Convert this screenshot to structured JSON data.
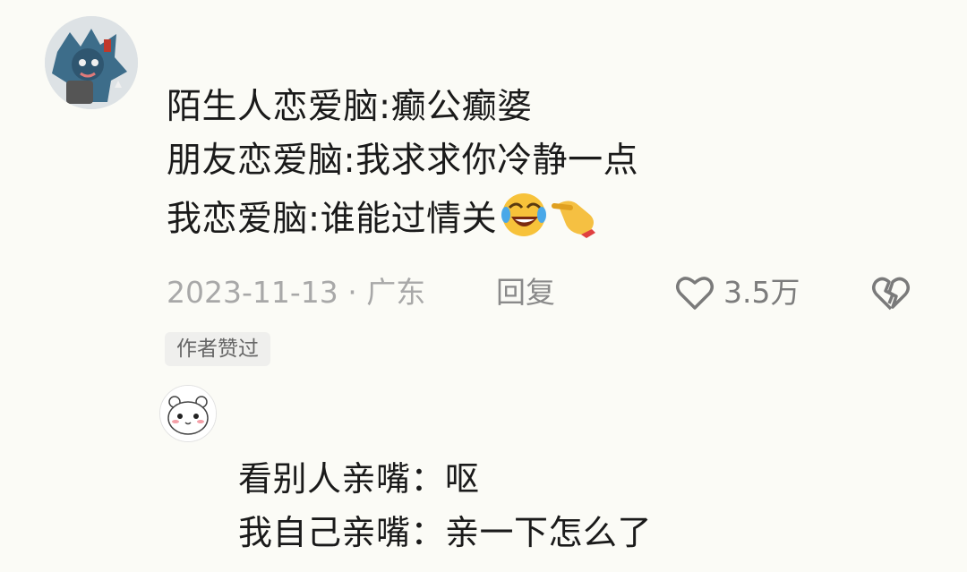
{
  "comment": {
    "lines": [
      "陌生人恋爱脑:癫公癫婆",
      "朋友恋爱脑:我求求你冷静一点",
      "我恋爱脑:谁能过情关"
    ],
    "emojis": [
      "rofl-emoji",
      "pointing-hand-emoji"
    ],
    "date": "2023-11-13 · 广东",
    "reply_label": "回复",
    "like_count": "3.5万",
    "author_badge": "作者赞过"
  },
  "reply": {
    "lines": [
      "看别人亲嘴：呕",
      "我自己亲嘴：亲一下怎么了"
    ]
  },
  "colors": {
    "background": "#fbfbf6",
    "text": "#1a1a1a",
    "meta_text": "#a8a8a8",
    "badge_bg": "#efefed"
  }
}
